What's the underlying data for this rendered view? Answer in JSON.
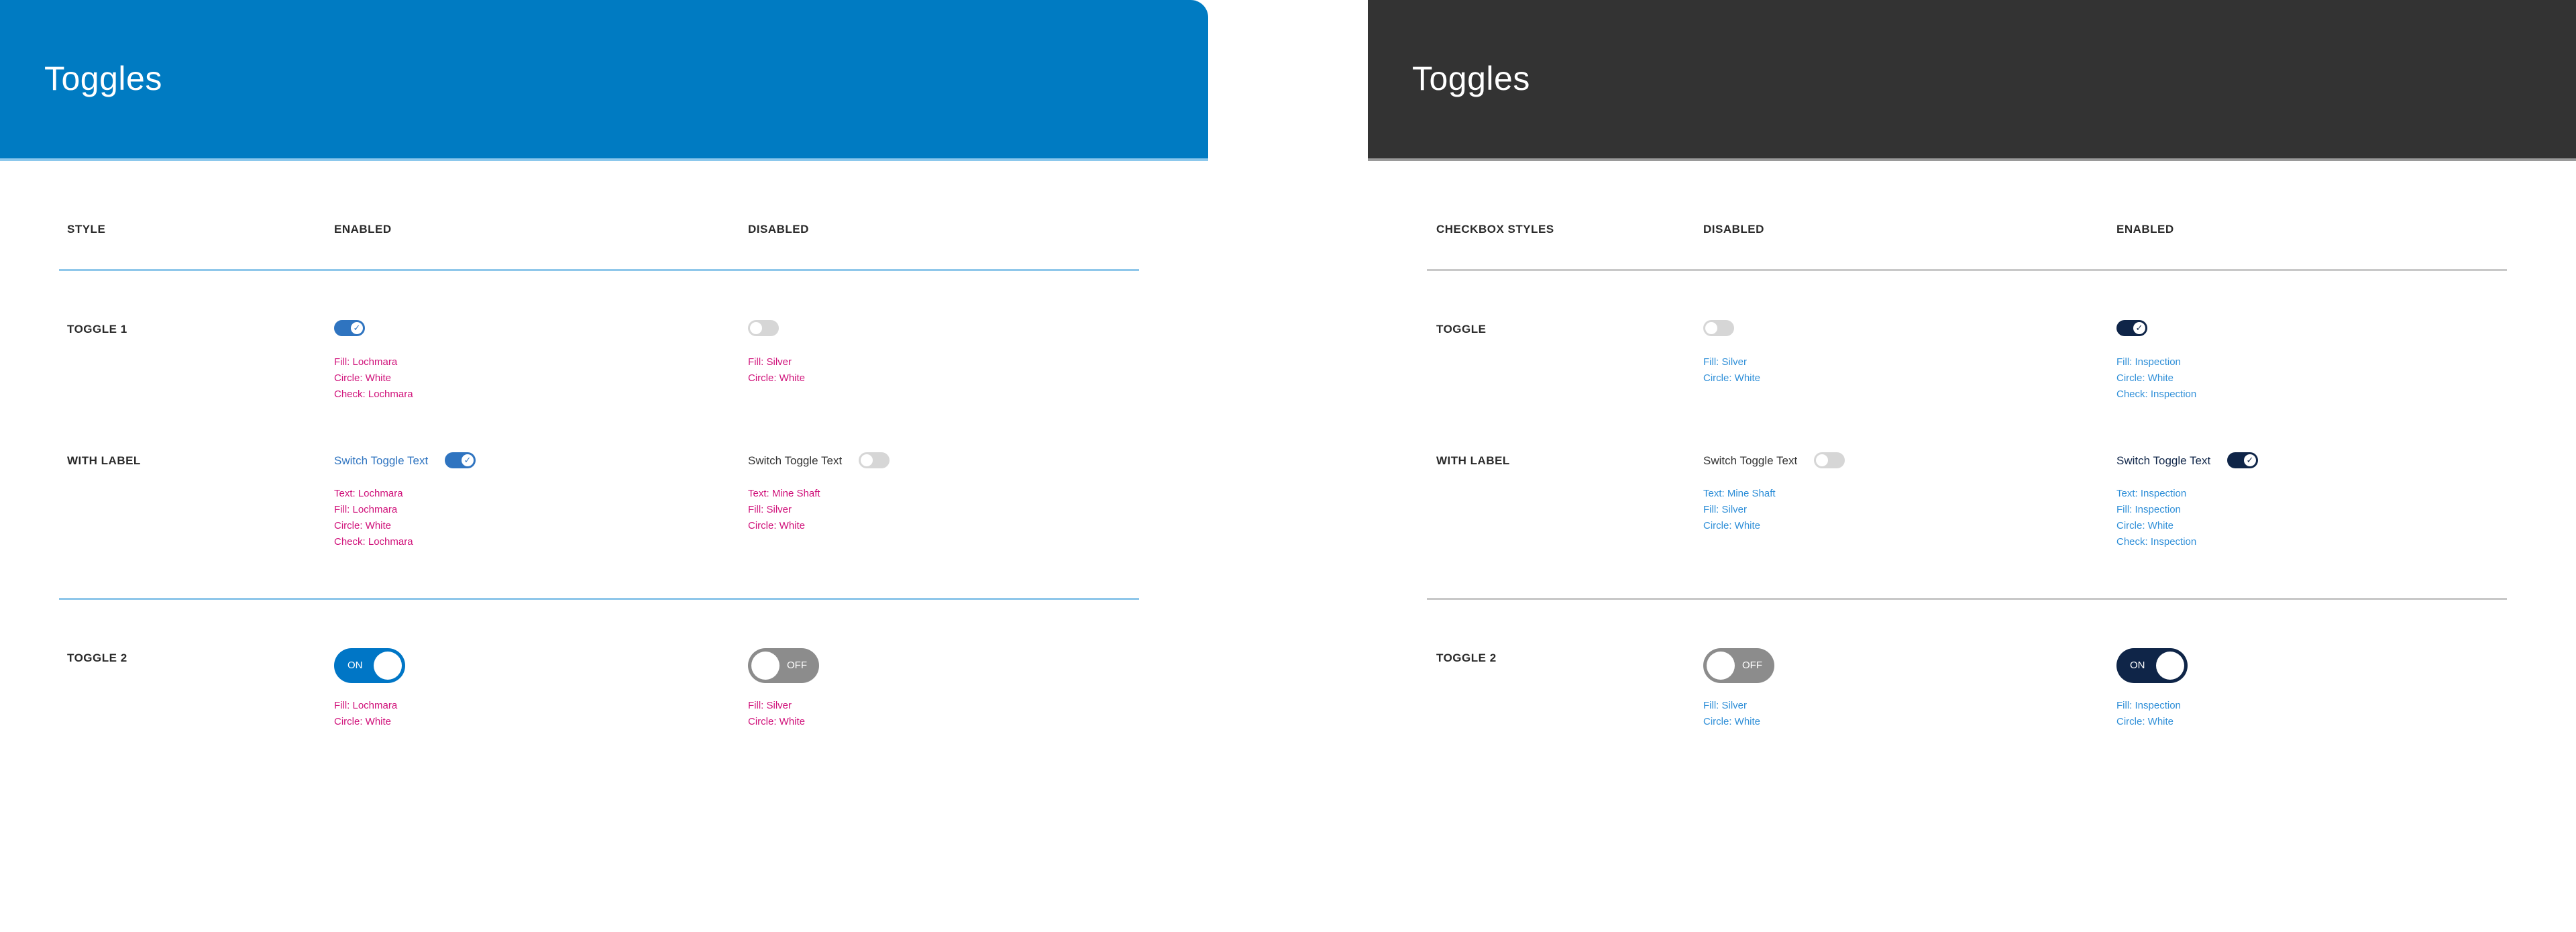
{
  "colors": {
    "left_header": "#007bc2",
    "right_header": "#333333",
    "left_on_fill": "#2f74c0",
    "left_big_on_fill": "#0076c6",
    "right_on_fill": "#0f2548",
    "off_fill": "#d6d6d6",
    "big_off_fill": "#8c8c8c",
    "left_spec_text": "#d0117a",
    "right_spec_text": "#2f8fd8"
  },
  "left": {
    "title": "Toggles",
    "columns": {
      "style": "STYLE",
      "enabled": "ENABLED",
      "disabled": "DISABLED"
    },
    "rows": {
      "toggle1": "TOGGLE 1",
      "with_label": "WITH LABEL",
      "toggle2": "TOGGLE 2"
    },
    "toggle1_enabled_spec": [
      "Fill: Lochmara",
      "Circle: White",
      "Check: Lochmara"
    ],
    "toggle1_disabled_spec": [
      "Fill: Silver",
      "Circle: White"
    ],
    "label_enabled_text": "Switch Toggle Text",
    "label_enabled_spec": [
      "Text: Lochmara",
      "Fill: Lochmara",
      "Circle: White",
      "Check: Lochmara"
    ],
    "label_disabled_text": "Switch Toggle Text",
    "label_disabled_spec": [
      "Text: Mine Shaft",
      "Fill: Silver",
      "Circle: White"
    ],
    "toggle2_on_label": "ON",
    "toggle2_off_label": "OFF",
    "toggle2_enabled_spec": [
      "Fill: Lochmara",
      "Circle: White"
    ],
    "toggle2_disabled_spec": [
      "Fill: Silver",
      "Circle: White"
    ]
  },
  "right": {
    "title": "Toggles",
    "columns": {
      "style": "CHECKBOX STYLES",
      "disabled": "DISABLED",
      "enabled": "ENABLED"
    },
    "rows": {
      "toggle1": "TOGGLE",
      "with_label": "WITH LABEL",
      "toggle2": "TOGGLE 2"
    },
    "toggle1_disabled_spec": [
      "Fill: Silver",
      "Circle: White"
    ],
    "toggle1_enabled_spec": [
      "Fill: Inspection",
      "Circle: White",
      "Check: Inspection"
    ],
    "label_disabled_text": "Switch Toggle Text",
    "label_disabled_spec": [
      "Text: Mine Shaft",
      "Fill: Silver",
      "Circle: White"
    ],
    "label_enabled_text": "Switch Toggle Text",
    "label_enabled_spec": [
      "Text: Inspection",
      "Fill: Inspection",
      "Circle: White",
      "Check: Inspection"
    ],
    "toggle2_off_label": "OFF",
    "toggle2_on_label": "ON",
    "toggle2_disabled_spec": [
      "Fill: Silver",
      "Circle: White"
    ],
    "toggle2_enabled_spec": [
      "Fill: Inspection",
      "Circle: White"
    ]
  }
}
